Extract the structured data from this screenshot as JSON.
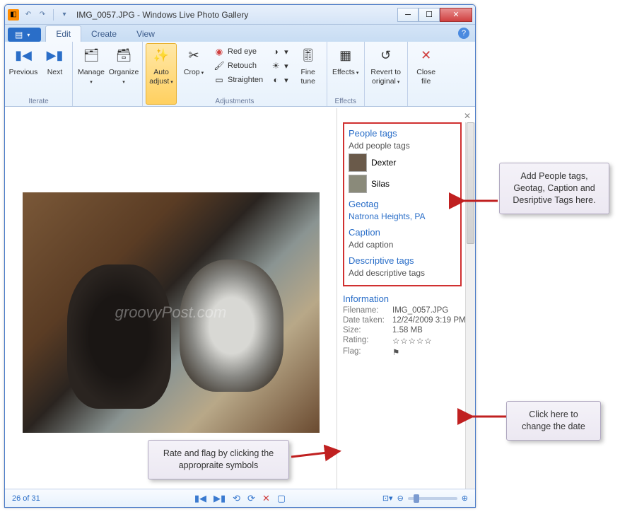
{
  "title": "IMG_0057.JPG - Windows Live Photo Gallery",
  "menu_label": "≡",
  "tabs": {
    "edit": "Edit",
    "create": "Create",
    "view": "View"
  },
  "ribbon": {
    "iterate": {
      "label": "Iterate",
      "previous": "Previous",
      "next": "Next"
    },
    "manage": "Manage",
    "organize": "Organize",
    "adjustments": {
      "label": "Adjustments",
      "auto_adjust": "Auto adjust",
      "crop": "Crop",
      "red_eye": "Red eye",
      "retouch": "Retouch",
      "straighten": "Straighten",
      "fine_tune": "Fine tune"
    },
    "effects": {
      "label": "Effects",
      "effects": "Effects"
    },
    "revert": "Revert to original",
    "close": "Close file"
  },
  "watermark": "groovyPost.com",
  "panel": {
    "people": {
      "h": "People tags",
      "add": "Add people tags",
      "p1": "Dexter",
      "p2": "Silas"
    },
    "geo": {
      "h": "Geotag",
      "val": "Natrona Heights, PA"
    },
    "caption": {
      "h": "Caption",
      "add": "Add caption"
    },
    "desc": {
      "h": "Descriptive tags",
      "add": "Add descriptive tags"
    },
    "info": {
      "h": "Information",
      "filename_k": "Filename:",
      "filename_v": "IMG_0057.JPG",
      "date_k": "Date taken:",
      "date_v": "12/24/2009  3:19 PM",
      "size_k": "Size:",
      "size_v": "1.58 MB",
      "rating_k": "Rating:",
      "flag_k": "Flag:"
    }
  },
  "status": {
    "counter": "26 of 31"
  },
  "callouts": {
    "c1": "Add People tags, Geotag, Caption and Desriptive Tags here.",
    "c2": "Click here to change the date",
    "c3": "Rate and flag by clicking the appropraite symbols"
  }
}
